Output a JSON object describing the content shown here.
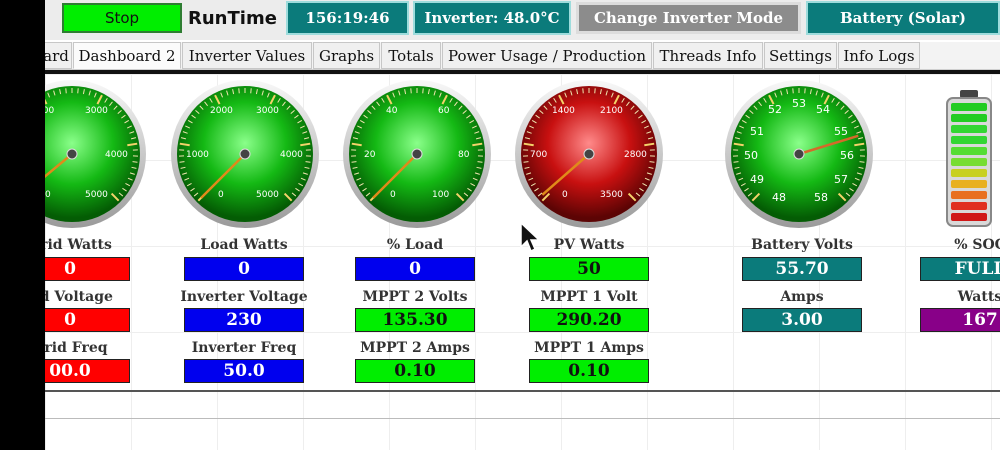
{
  "header": {
    "stop_label": "Stop",
    "runtime_label": "RunTime",
    "runtime_value": "156:19:46",
    "inverter_temp": "Inverter: 48.0°C",
    "change_mode_label": "Change Inverter Mode",
    "battery_mode": "Battery (Solar)"
  },
  "tabs": [
    {
      "label": "ard",
      "active": false
    },
    {
      "label": "Dashboard 2",
      "active": true
    },
    {
      "label": "Inverter Values",
      "active": false
    },
    {
      "label": "Graphs",
      "active": false
    },
    {
      "label": "Totals",
      "active": false
    },
    {
      "label": "Power Usage / Production",
      "active": false
    },
    {
      "label": "Threads Info",
      "active": false
    },
    {
      "label": "Settings",
      "active": false
    },
    {
      "label": "Info Logs",
      "active": false
    }
  ],
  "gauges": [
    {
      "ticks": [
        "000",
        "3000",
        "4000",
        "5000",
        "0"
      ],
      "value_fraction": 0.02,
      "theme": "green"
    },
    {
      "ticks": [
        "1000",
        "2000",
        "3000",
        "4000",
        "5000",
        "0"
      ],
      "value_fraction": 0.0,
      "theme": "green"
    },
    {
      "ticks": [
        "20",
        "40",
        "60",
        "80",
        "100",
        "0"
      ],
      "value_fraction": 0.0,
      "theme": "green"
    },
    {
      "ticks": [
        "700",
        "1400",
        "2100",
        "2800",
        "3500",
        "0"
      ],
      "value_fraction": 0.014,
      "theme": "red"
    },
    {
      "ticks": [
        "48",
        "49",
        "50",
        "51",
        "52",
        "53",
        "54",
        "55",
        "56",
        "57",
        "58"
      ],
      "value_fraction": 0.77,
      "theme": "green"
    }
  ],
  "columns": [
    {
      "items": [
        {
          "label": "Grid Watts",
          "value": "0",
          "color": "red"
        },
        {
          "label": "rid Voltage",
          "value": "0",
          "color": "red"
        },
        {
          "label": "Grid Freq",
          "value": "00.0",
          "color": "red"
        }
      ]
    },
    {
      "items": [
        {
          "label": "Load Watts",
          "value": "0",
          "color": "blue"
        },
        {
          "label": "Inverter Voltage",
          "value": "230",
          "color": "blue"
        },
        {
          "label": "Inverter Freq",
          "value": "50.0",
          "color": "blue"
        }
      ]
    },
    {
      "items": [
        {
          "label": "% Load",
          "value": "0",
          "color": "blue"
        },
        {
          "label": "MPPT 2 Volts",
          "value": "135.30",
          "color": "green"
        },
        {
          "label": "MPPT 2 Amps",
          "value": "0.10",
          "color": "green"
        }
      ]
    },
    {
      "items": [
        {
          "label": "PV Watts",
          "value": "50",
          "color": "green"
        },
        {
          "label": "MPPT 1 Volt",
          "value": "290.20",
          "color": "green"
        },
        {
          "label": "MPPT 1 Amps",
          "value": "0.10",
          "color": "green"
        }
      ]
    },
    {
      "items": [
        {
          "label": "Battery Volts",
          "value": "55.70",
          "color": "teal"
        },
        {
          "label": "Amps",
          "value": "3.00",
          "color": "teal"
        }
      ]
    },
    {
      "items": [
        {
          "label": "% SOC",
          "value": "FULL",
          "color": "teal"
        },
        {
          "label": "Watts",
          "value": "167",
          "color": "purple"
        }
      ]
    }
  ],
  "battery_icon": {
    "name": "battery-level-icon",
    "level_fraction": 1.0
  },
  "colors": {
    "teal": "#0b7b7b",
    "red": "#ff0000",
    "blue": "#0000ee",
    "green": "#00ee00",
    "purple": "#880088"
  }
}
